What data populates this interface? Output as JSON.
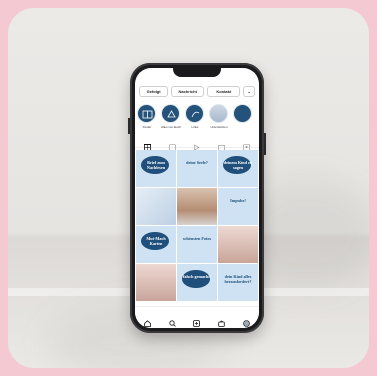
{
  "header": {
    "follow_label": "Gefolgt",
    "message_label": "Nachricht",
    "contact_label": "Kontakt",
    "more_label": "⌄"
  },
  "highlights": [
    {
      "label": "Kinder"
    },
    {
      "label": "Alles von Euch"
    },
    {
      "label": "Links"
    },
    {
      "label": "Unterstützen"
    }
  ],
  "tiles": [
    {
      "text": "Brief zum Nachlesen",
      "style": "blob"
    },
    {
      "text": "deine Seele?",
      "style": "plain"
    },
    {
      "text": "deinem Kind zu sagen",
      "style": "blob"
    },
    {
      "text": "",
      "style": "photo1"
    },
    {
      "text": "",
      "style": "photo2"
    },
    {
      "text": "Impulse!",
      "style": "plain"
    },
    {
      "text": "Mut-Mach Karten",
      "style": "blob"
    },
    {
      "text": "schönsten Fotos",
      "style": "plain"
    },
    {
      "text": "",
      "style": "photo3"
    },
    {
      "text": "",
      "style": "photo3"
    },
    {
      "text": "falsch gemacht!",
      "style": "blob"
    },
    {
      "text": "dein Kind alles herausfordert?",
      "style": "plain"
    }
  ],
  "colors": {
    "brand": "#1f4f7a",
    "tile_bg": "#cfe2f3"
  }
}
